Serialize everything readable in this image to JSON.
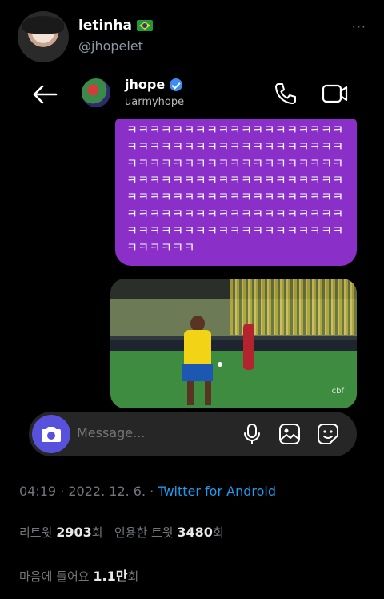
{
  "tweet": {
    "display_name": "letinha",
    "flag_icon": "brazil-flag-icon",
    "handle": "@jhopelet",
    "more_label": "···"
  },
  "dm": {
    "name": "jhope",
    "username": "uarmyhope",
    "message_text": "ㅋㅋㅋㅋㅋㅋㅋㅋㅋㅋㅋㅋㅋㅋㅋㅋㅋㅋㅋㅋㅋㅋㅋㅋㅋㅋㅋㅋㅋㅋㅋㅋㅋㅋㅋㅋㅋㅋㅋㅋㅋㅋㅋㅋㅋㅋㅋㅋㅋㅋㅋㅋㅋㅋㅋㅋㅋㅋㅋㅋㅋㅋㅋㅋㅋㅋㅋㅋㅋㅋㅋㅋㅋㅋㅋㅋㅋㅋㅋㅋㅋㅋㅋㅋㅋㅋㅋㅋㅋㅋㅋㅋㅋㅋㅋㅋㅋㅋㅋㅋㅋㅋㅋㅋㅋㅋㅋㅋㅋㅋㅋㅋㅋㅋㅋㅋㅋㅋㅋㅋㅋㅋㅋㅋㅋㅋㅋㅋㅋㅋㅋㅋㅋㅋㅋㅋㅋㅋㅋ",
    "media_watermark": "cbf",
    "composer_placeholder": "Message...",
    "bubble_color": "#8a2fc7",
    "camera_color": "#5851db"
  },
  "meta": {
    "time": "04:19",
    "sep1": " · ",
    "date": "2022. 12. 6.",
    "sep2": " · ",
    "source": "Twitter for Android",
    "source_color": "#1d9bf0"
  },
  "stats": {
    "retweets_label": "리트윗",
    "retweets_count": "2903",
    "retweets_unit": "회",
    "quotes_label": "인용한 트윗",
    "quotes_count": "3480",
    "quotes_unit": "회",
    "likes_label": "마음에 들어요",
    "likes_count": "1.1만",
    "likes_unit": "회"
  }
}
